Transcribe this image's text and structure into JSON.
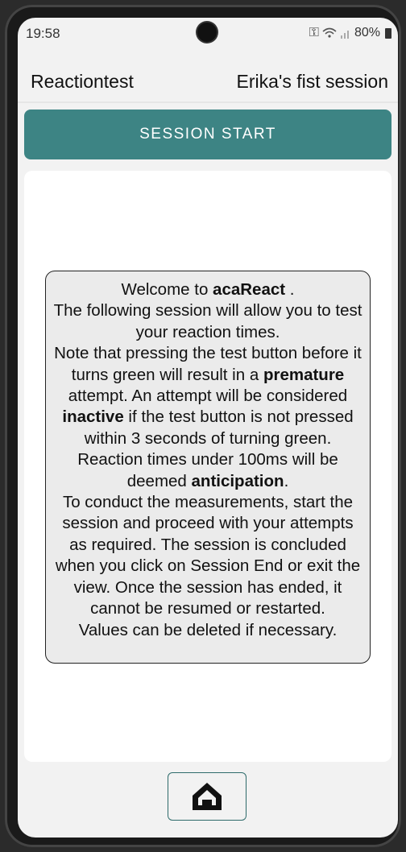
{
  "status_bar": {
    "time": "19:58",
    "battery": "80%"
  },
  "app_bar": {
    "title": "Reactiontest",
    "session_name": "Erika's fist session"
  },
  "session_button": {
    "label": "SESSION START"
  },
  "info": {
    "p1": "Welcome to ",
    "app_name": "acaReact",
    "p2": " .",
    "p3": "The following session will allow you to test your reaction times.",
    "p4": "Note that pressing the test button before it turns green will result in a ",
    "premature": "premature",
    "p5": " attempt. An attempt will be considered ",
    "inactive": "inactive",
    "p6": " if the test button is not pressed within 3 seconds of turning green. Reaction times under 100ms will be deemed ",
    "anticipation": "anticipation",
    "p7": ".",
    "p8": "To conduct the measurements, start the session and proceed with your attempts as required. The session is concluded when you click on Session End or exit the view. Once the session has ended, it cannot be resumed or restarted.",
    "p9": "Values can be deleted if necessary."
  },
  "nav": {
    "home_icon": "home-icon"
  }
}
